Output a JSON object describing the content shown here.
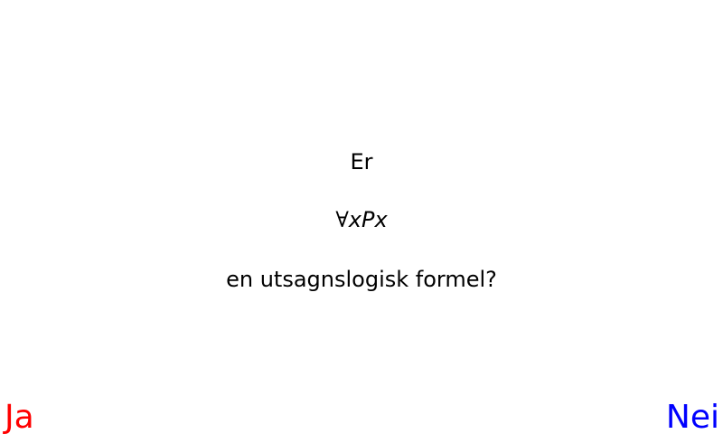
{
  "question": {
    "prefix": "Er",
    "formula": {
      "quantifier": "∀",
      "variable": "x",
      "predicate": "P",
      "argument": "x"
    },
    "suffix": "en utsagnslogisk formel?"
  },
  "answers": {
    "yes": {
      "label": "Ja",
      "color": "#ff0000"
    },
    "no": {
      "label": "Nei",
      "color": "#0000ff"
    }
  }
}
